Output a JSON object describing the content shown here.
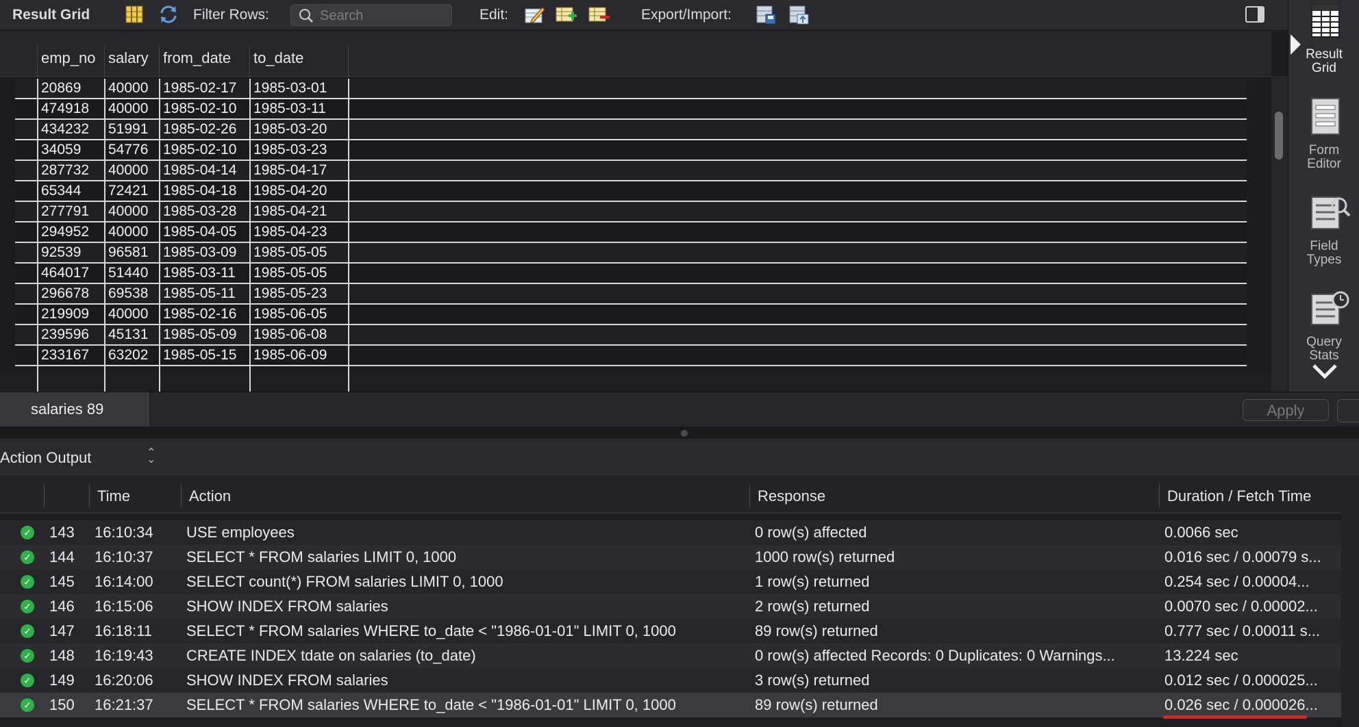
{
  "toolbar": {
    "result_grid_label": "Result Grid",
    "filter_rows_label": "Filter Rows:",
    "search_placeholder": "Search",
    "edit_label": "Edit:",
    "export_import_label": "Export/Import:"
  },
  "sidebar": {
    "items": [
      {
        "label_1": "Result",
        "label_2": "Grid",
        "icon": "result-grid-icon",
        "active": true
      },
      {
        "label_1": "Form",
        "label_2": "Editor",
        "icon": "form-editor-icon"
      },
      {
        "label_1": "Field",
        "label_2": "Types",
        "icon": "field-types-icon"
      },
      {
        "label_1": "Query",
        "label_2": "Stats",
        "icon": "query-stats-icon"
      }
    ]
  },
  "grid": {
    "columns": [
      "emp_no",
      "salary",
      "from_date",
      "to_date"
    ],
    "rows": [
      [
        "20869",
        "40000",
        "1985-02-17",
        "1985-03-01"
      ],
      [
        "474918",
        "40000",
        "1985-02-10",
        "1985-03-11"
      ],
      [
        "434232",
        "51991",
        "1985-02-26",
        "1985-03-20"
      ],
      [
        "34059",
        "54776",
        "1985-02-10",
        "1985-03-23"
      ],
      [
        "287732",
        "40000",
        "1985-04-14",
        "1985-04-17"
      ],
      [
        "65344",
        "72421",
        "1985-04-18",
        "1985-04-20"
      ],
      [
        "277791",
        "40000",
        "1985-03-28",
        "1985-04-21"
      ],
      [
        "294952",
        "40000",
        "1985-04-05",
        "1985-04-23"
      ],
      [
        "92539",
        "96581",
        "1985-03-09",
        "1985-05-05"
      ],
      [
        "464017",
        "51440",
        "1985-03-11",
        "1985-05-05"
      ],
      [
        "296678",
        "69538",
        "1985-05-11",
        "1985-05-23"
      ],
      [
        "219909",
        "40000",
        "1985-02-16",
        "1985-06-05"
      ],
      [
        "239596",
        "45131",
        "1985-05-09",
        "1985-06-08"
      ],
      [
        "233167",
        "63202",
        "1985-05-15",
        "1985-06-09"
      ]
    ]
  },
  "tabs": {
    "result_tab": "salaries 89",
    "apply_label": "Apply"
  },
  "output": {
    "title": "Action Output",
    "columns": [
      "Time",
      "Action",
      "Response",
      "Duration / Fetch Time"
    ],
    "rows": [
      {
        "num": "143",
        "time": "16:10:34",
        "action": "USE employees",
        "response": "0 row(s) affected",
        "duration": "0.0066 sec"
      },
      {
        "num": "144",
        "time": "16:10:37",
        "action": "SELECT * FROM salaries LIMIT 0, 1000",
        "response": "1000 row(s) returned",
        "duration": "0.016 sec / 0.00079 s..."
      },
      {
        "num": "145",
        "time": "16:14:00",
        "action": "SELECT count(*) FROM salaries LIMIT 0, 1000",
        "response": "1 row(s) returned",
        "duration": "0.254 sec / 0.00004..."
      },
      {
        "num": "146",
        "time": "16:15:06",
        "action": "SHOW INDEX FROM salaries",
        "response": "2 row(s) returned",
        "duration": "0.0070 sec / 0.00002..."
      },
      {
        "num": "147",
        "time": "16:18:11",
        "action": "SELECT * FROM salaries WHERE to_date < \"1986-01-01\" LIMIT 0, 1000",
        "response": "89 row(s) returned",
        "duration": "0.777 sec / 0.00011 s..."
      },
      {
        "num": "148",
        "time": "16:19:43",
        "action": "CREATE INDEX tdate on salaries (to_date)",
        "response": "0 row(s) affected Records: 0  Duplicates: 0  Warnings...",
        "duration": "13.224 sec"
      },
      {
        "num": "149",
        "time": "16:20:06",
        "action": "SHOW INDEX FROM salaries",
        "response": "3 row(s) returned",
        "duration": "0.012 sec / 0.000025..."
      },
      {
        "num": "150",
        "time": "16:21:37",
        "action": "SELECT * FROM salaries WHERE to_date < \"1986-01-01\" LIMIT 0, 1000",
        "response": "89 row(s) returned",
        "duration": "0.026 sec / 0.000026...",
        "selected": true
      }
    ]
  },
  "colors": {
    "accent_underline": "#e0201a",
    "success": "#2fb14a"
  }
}
